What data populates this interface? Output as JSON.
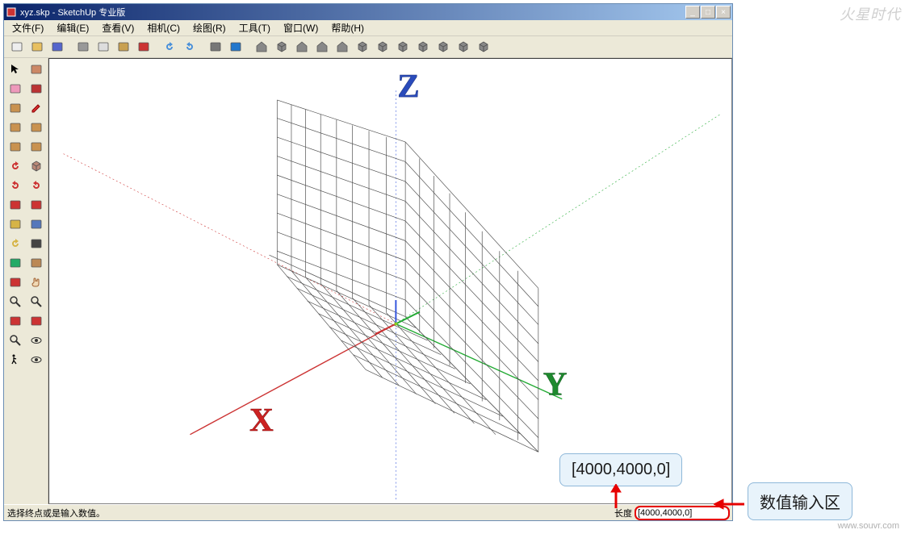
{
  "window": {
    "title": "xyz.skp - SketchUp 专业版",
    "win_btns": {
      "min": "_",
      "max": "□",
      "close": "×"
    }
  },
  "menubar": [
    {
      "label": "文件(F)"
    },
    {
      "label": "编辑(E)"
    },
    {
      "label": "查看(V)"
    },
    {
      "label": "相机(C)"
    },
    {
      "label": "绘图(R)"
    },
    {
      "label": "工具(T)"
    },
    {
      "label": "窗口(W)"
    },
    {
      "label": "帮助(H)"
    }
  ],
  "toolbar_top_icons": [
    "new",
    "open",
    "save",
    "cut",
    "copy",
    "paste",
    "delete",
    "undo",
    "redo",
    "print",
    "info",
    "house-a",
    "box-a",
    "house-b",
    "house-c",
    "house-d",
    "box-b",
    "cyl",
    "sphere",
    "cone",
    "torus",
    "layers",
    "globe"
  ],
  "toolbar_left_rows": [
    [
      "select",
      "paint"
    ],
    [
      "eraser",
      "material"
    ],
    [
      "rect",
      "pencil"
    ],
    [
      "circle",
      "arc"
    ],
    [
      "poly",
      "freehand"
    ],
    [
      "rotate3d",
      "iso"
    ],
    [
      "rot-ccw",
      "rot-cw"
    ],
    [
      "pan-l",
      "pan-r"
    ],
    [
      "tape",
      "dim"
    ],
    [
      "protractor",
      "text"
    ],
    [
      "axes",
      "section"
    ],
    [
      "orbit",
      "hand"
    ],
    [
      "zoom",
      "zoom-ext"
    ],
    [
      "zoom-win",
      "prev"
    ],
    [
      "dropper",
      "look"
    ],
    [
      "walk",
      "eye"
    ]
  ],
  "viewport": {
    "axis_labels": {
      "x": "X",
      "y": "Y",
      "z": "Z"
    }
  },
  "statusbar": {
    "hint": "选择终点或是输入数值。",
    "length_label": "长度",
    "length_value": "[4000,4000,0]"
  },
  "annotations": {
    "callout_1": "[4000,4000,0]",
    "callout_2": "数值输入区"
  },
  "watermarks": {
    "top": "火星时代",
    "bottom": "www.souvr.com"
  }
}
